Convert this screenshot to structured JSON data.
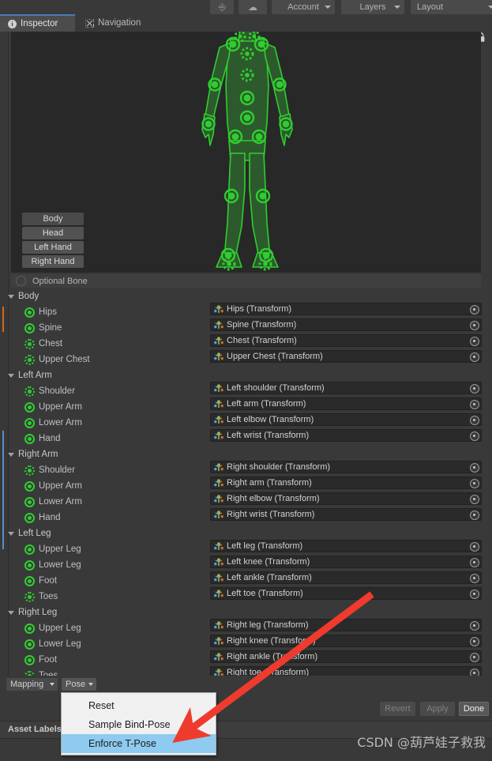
{
  "colors": {
    "bone_green": "#2fce2f",
    "accent_blue": "#4a79b8",
    "menu_highlight": "#8fcbf0",
    "arrow_red": "#ef3b2d",
    "panel_bg": "#393939",
    "preview_bg": "#282828",
    "strip_orange": "#d06a1a",
    "strip_blue": "#5a8ec4"
  },
  "unity_toolbar": {
    "collab_icon": "collab-icon",
    "cloud_icon": "cloud-icon",
    "buttons": [
      {
        "label": "Account",
        "icon": "chevron-down-icon"
      },
      {
        "label": "Layers",
        "icon": "chevron-down-icon"
      },
      {
        "label": "Layout",
        "icon": "chevron-down-icon"
      }
    ]
  },
  "tabs": [
    {
      "label": "Inspector",
      "icon": "info-icon",
      "active": true
    },
    {
      "label": "Navigation",
      "icon": "navigation-icon",
      "active": false
    }
  ],
  "lock_icon": "lock-icon",
  "avatar_preview": {
    "icon": "humanoid-avatar-diagram",
    "part_buttons": [
      {
        "label": "Body",
        "selected": true
      },
      {
        "label": "Head",
        "selected": false
      },
      {
        "label": "Left Hand",
        "selected": false
      },
      {
        "label": "Right Hand",
        "selected": false
      }
    ]
  },
  "optional_bone_legend": {
    "label": "Optional Bone",
    "icon": "dashed-circle-icon"
  },
  "bone_groups": [
    {
      "name": "Body",
      "expanded": true,
      "bones": [
        {
          "label": "Hips",
          "state": "solid",
          "transform": "Hips (Transform)"
        },
        {
          "label": "Spine",
          "state": "solid",
          "transform": "Spine (Transform)"
        },
        {
          "label": "Chest",
          "state": "dashed",
          "transform": "Chest (Transform)"
        },
        {
          "label": "Upper Chest",
          "state": "dashed",
          "transform": "Upper Chest (Transform)"
        }
      ]
    },
    {
      "name": "Left Arm",
      "expanded": true,
      "bones": [
        {
          "label": "Shoulder",
          "state": "dashed",
          "transform": "Left shoulder (Transform)"
        },
        {
          "label": "Upper Arm",
          "state": "solid",
          "transform": "Left arm (Transform)"
        },
        {
          "label": "Lower Arm",
          "state": "solid",
          "transform": "Left elbow (Transform)"
        },
        {
          "label": "Hand",
          "state": "solid",
          "transform": "Left wrist (Transform)"
        }
      ]
    },
    {
      "name": "Right Arm",
      "expanded": true,
      "bones": [
        {
          "label": "Shoulder",
          "state": "dashed",
          "transform": "Right shoulder (Transform)"
        },
        {
          "label": "Upper Arm",
          "state": "solid",
          "transform": "Right arm (Transform)"
        },
        {
          "label": "Lower Arm",
          "state": "solid",
          "transform": "Right elbow (Transform)"
        },
        {
          "label": "Hand",
          "state": "solid",
          "transform": "Right wrist (Transform)"
        }
      ]
    },
    {
      "name": "Left Leg",
      "expanded": true,
      "bones": [
        {
          "label": "Upper Leg",
          "state": "solid",
          "transform": "Left leg (Transform)"
        },
        {
          "label": "Lower Leg",
          "state": "solid",
          "transform": "Left knee (Transform)"
        },
        {
          "label": "Foot",
          "state": "solid",
          "transform": "Left ankle (Transform)"
        },
        {
          "label": "Toes",
          "state": "dashed",
          "transform": "Left toe (Transform)"
        }
      ]
    },
    {
      "name": "Right Leg",
      "expanded": true,
      "bones": [
        {
          "label": "Upper Leg",
          "state": "solid",
          "transform": "Right leg (Transform)"
        },
        {
          "label": "Lower Leg",
          "state": "solid",
          "transform": "Right knee (Transform)"
        },
        {
          "label": "Foot",
          "state": "solid",
          "transform": "Right ankle (Transform)"
        },
        {
          "label": "Toes",
          "state": "dashed",
          "transform": "Right toe (Transform)"
        }
      ]
    }
  ],
  "bottom_bar": {
    "mapping_label": "Mapping",
    "pose_label": "Pose",
    "caret_icon": "chevron-down-icon"
  },
  "pose_menu": {
    "open": true,
    "items": [
      {
        "label": "Reset",
        "highlighted": false
      },
      {
        "label": "Sample Bind-Pose",
        "highlighted": false
      },
      {
        "label": "Enforce T-Pose",
        "highlighted": true
      }
    ]
  },
  "action_buttons": [
    {
      "label": "Revert",
      "enabled": false
    },
    {
      "label": "Apply",
      "enabled": false
    },
    {
      "label": "Done",
      "enabled": true
    }
  ],
  "asset_label": {
    "title": "Asset Labels"
  },
  "annotation": {
    "arrow": "red-arrow-pointing-to-enforce-t-pose"
  },
  "watermark": {
    "text": "CSDN @葫芦娃子救我"
  }
}
